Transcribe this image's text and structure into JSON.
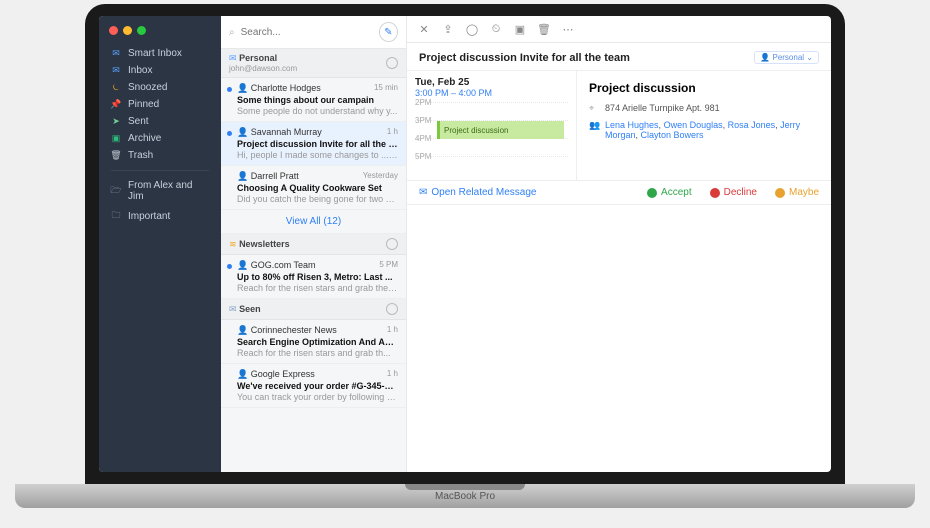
{
  "sidebar": {
    "items": [
      {
        "icon": "✉",
        "color": "#5aa0ff",
        "label": "Smart Inbox"
      },
      {
        "icon": "✉",
        "color": "#5aa0ff",
        "label": "Inbox"
      },
      {
        "icon": "⏾",
        "color": "#f5a623",
        "label": "Snoozed"
      },
      {
        "icon": "📌",
        "color": "#e86a3f",
        "label": "Pinned"
      },
      {
        "icon": "➤",
        "color": "#6fcf97",
        "label": "Sent"
      },
      {
        "icon": "▣",
        "color": "#2dbd7a",
        "label": "Archive"
      },
      {
        "icon": "🗑",
        "color": "#c0c7d1",
        "label": "Trash"
      }
    ],
    "folders": [
      {
        "icon": "🗁",
        "label": "From Alex and Jim"
      },
      {
        "icon": "🗀",
        "label": "Important"
      }
    ]
  },
  "search": {
    "placeholder": "Search..."
  },
  "message_list": {
    "sections": [
      {
        "title": "Personal",
        "subtitle": "john@dawson.com",
        "icon": "✉",
        "iconColor": "#5aa0ff",
        "messages": [
          {
            "sender": "Charlotte Hodges",
            "time": "15 min",
            "subject": "Some things about our campain",
            "preview": "Some people do not understand why y...",
            "unread": true
          },
          {
            "sender": "Savannah Murray",
            "time": "1 h",
            "subject": "Project discussion Invite for all the team",
            "preview": "Hi, people I made some changes to ...",
            "unread": true,
            "attachment": true,
            "selected": true
          },
          {
            "sender": "Darrell Pratt",
            "time": "Yesterday",
            "subject": "Choosing A Quality Cookware Set",
            "preview": "Did you catch the being gone for two w...",
            "unread": false
          }
        ],
        "viewall": "View All (12)"
      },
      {
        "title": "Newsletters",
        "icon": "≋",
        "iconColor": "#f5a623",
        "messages": [
          {
            "sender": "GOG.com Team",
            "time": "5 PM",
            "subject": "Up to 80% off Risen 3, Metro: Last ...",
            "preview": "Reach for the risen stars and grab them...",
            "unread": true
          }
        ]
      },
      {
        "title": "Seen",
        "icon": "✉",
        "iconColor": "#8aa4c8",
        "messages": [
          {
            "sender": "Corinnechester News",
            "time": "1 h",
            "subject": "Search Engine Optimization And Adve...",
            "preview": "Reach for the risen stars and grab th..."
          },
          {
            "sender": "Google Express",
            "time": "1 h",
            "subject": "We've received your order #G-345-04...",
            "preview": "You can track your order by following th..."
          }
        ]
      }
    ]
  },
  "reader": {
    "title": "Project discussion Invite for all the team",
    "tag": "Personal",
    "event": {
      "date": "Tue, Feb 25",
      "range": "3:00 PM – 4:00 PM",
      "hours": [
        "2PM",
        "3PM",
        "4PM",
        "5PM"
      ],
      "chip": "Project discussion",
      "name": "Project discussion",
      "location": "874 Arielle Turnpike Apt. 981",
      "attendees": [
        "Lena Hughes",
        "Owen Douglas",
        "Rosa Jones",
        "Jerry Morgan",
        "Clayton Bowers"
      ]
    },
    "actions": {
      "related": "Open Related Message",
      "accept": "Accept",
      "decline": "Decline",
      "maybe": "Maybe"
    }
  },
  "laptop_label": "MacBook Pro"
}
